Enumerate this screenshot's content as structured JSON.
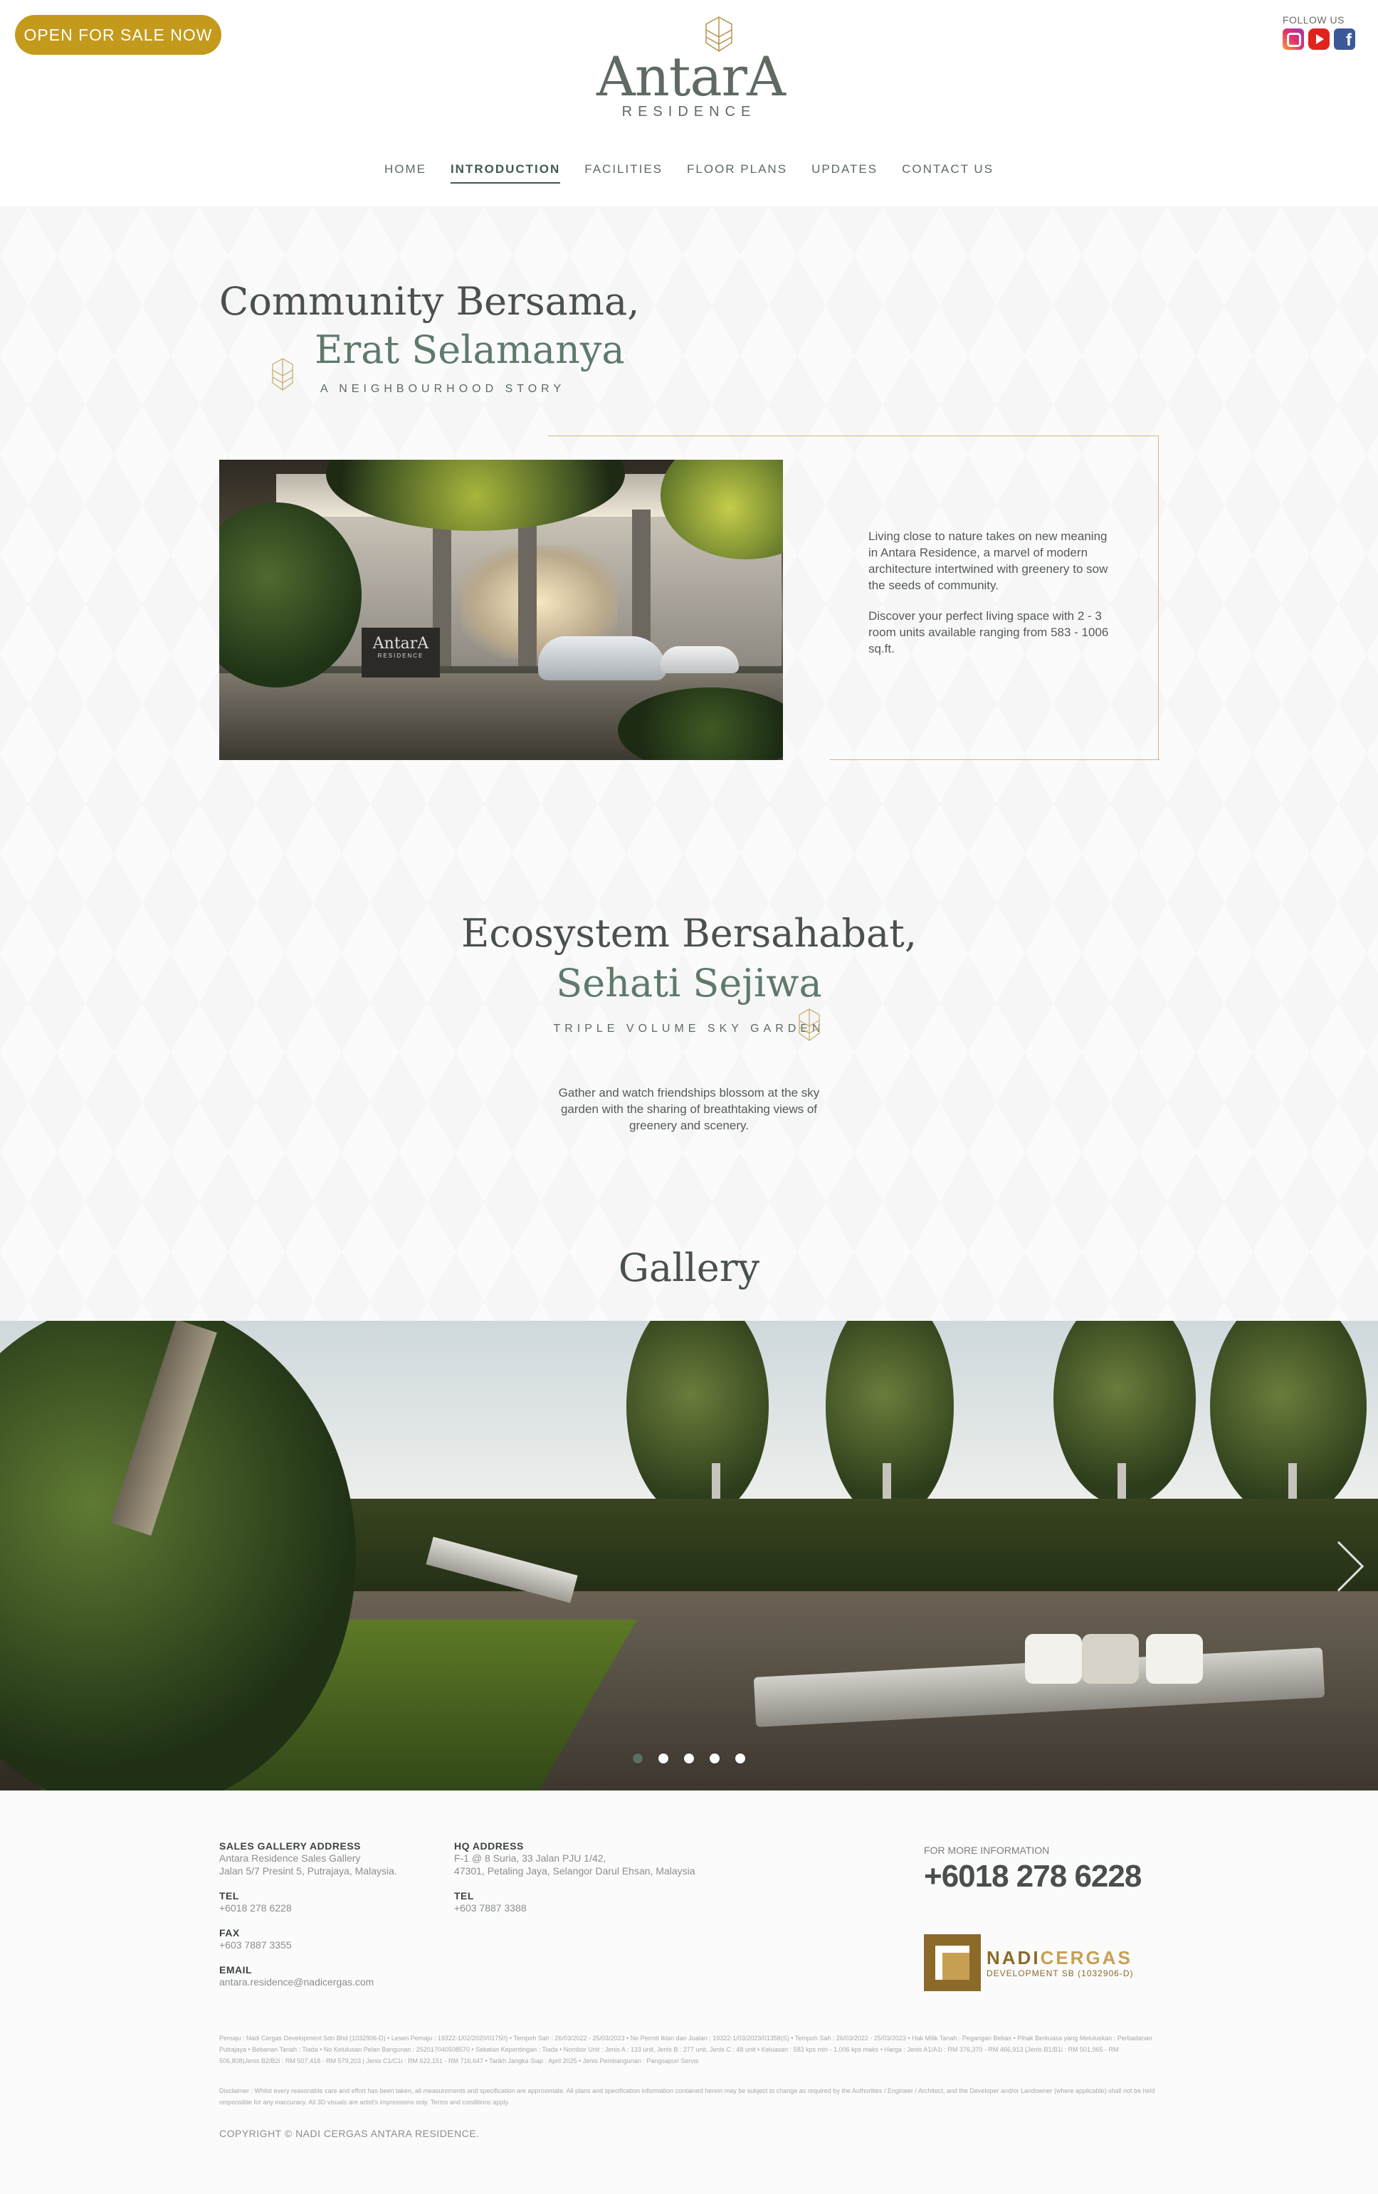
{
  "header": {
    "sale_button": "OPEN FOR SALE NOW",
    "logo_name": "AntarA",
    "logo_sub": "RESIDENCE",
    "follow_label": "FOLLOW US",
    "social_icons": [
      "instagram-icon",
      "youtube-icon",
      "facebook-icon"
    ]
  },
  "nav": {
    "items": [
      {
        "label": "HOME"
      },
      {
        "label": "INTRODUCTION",
        "active": true
      },
      {
        "label": "FACILITIES"
      },
      {
        "label": "FLOOR PLANS"
      },
      {
        "label": "UPDATES"
      },
      {
        "label": "CONTACT US"
      }
    ]
  },
  "section1": {
    "title_line1": "Community Bersama,",
    "title_line2": "Erat Selamanya",
    "subtitle": "A NEIGHBOURHOOD STORY",
    "photo_sign": "AntarA",
    "photo_sign_sub": "RESIDENCE",
    "paragraph1": "Living close to nature takes on new meaning in Antara Residence, a marvel of modern architecture intertwined with greenery to sow the seeds of community.",
    "paragraph2": "Discover your perfect living space with 2 - 3 room units available ranging from 583 - 1006 sq.ft."
  },
  "section2": {
    "title_line1": "Ecosystem Bersahabat,",
    "title_line2": "Sehati Sejiwa",
    "subtitle": "TRIPLE VOLUME SKY GARDEN",
    "paragraph": "Gather and watch friendships blossom at the sky garden with the sharing of breathtaking views of greenery and scenery."
  },
  "gallery": {
    "title": "Gallery",
    "slide_count": 5,
    "active_slide": 1
  },
  "footer": {
    "sales_gallery": {
      "heading": "SALES GALLERY ADDRESS",
      "line1": "Antara Residence Sales Gallery",
      "line2": "Jalan 5/7 Presint 5, Putrajaya, Malaysia."
    },
    "hq": {
      "heading": "HQ ADDRESS",
      "line1": "F-1 @ 8 Suria, 33 Jalan PJU 1/42,",
      "line2": "47301, Petaling Jaya, Selangor Darul Ehsan, Malaysia"
    },
    "tel_heading": "TEL",
    "sales_tel": "+6018 278 6228",
    "hq_tel": "+603 7887 3388",
    "fax_heading": "FAX",
    "fax": "+603 7887 3355",
    "email_heading": "EMAIL",
    "email": "antara.residence@nadicergas.com",
    "more_info_label": "FOR MORE INFORMATION",
    "more_info_phone": "+6018 278 6228",
    "developer_name_a": "NADI",
    "developer_name_b": "CERGAS",
    "developer_sub": "DEVELOPMENT SB (1032906-D)",
    "fine_print_1": "Pemaju : Nadi Cergas Development Sdn Bhd (1032906-D) • Lesen Pemaju : 19322-1/02/2020/01750) • Tempoh Sah : 26/03/2022 - 25/03/2023 • No Permit Iklan dan Jualan : 19322-1/03/2023/01358(S) • Tempoh Sah : 26/03/2022 - 25/03/2023 • Hak Milik Tanah : Pegangan Bebas • Pihak Berkuasa yang Meluluskan : Perbadanan Putrajaya • Bebanan Tanah : Tiada • No Kelulusan Pelan Bangunan : 252017040508570 • Sekatan Kepentingan : Tiada • Nombor Unit : Jenis A : 133 unit, Jenis B : 277 unit, Jenis C : 48 unit • Keluasan : 583 kps min - 1,006 kps maks • Harga : Jenis A1/A1i : RM 376,370 - RM 466,913 (Jenis B1/B1i : RM 501,965 - RM 506,808)Jenis B2/B2i : RM 507,418 - RM 579,203 | Jenis C1/C1i : RM 622,151 - RM 716,647 • Tarikh Jangka Siap : April 2025 • Jenis Pembangunan : Pangsapuri Servis",
    "fine_print_2": "Disclaimer : Whilst every reasonable care and effort has been taken, all measurements and specification are approximate. All plans and specification information contained herein may be subject to change as required by the Authorities / Engineer / Architect, and the Developer and/or Landowner (where applicable) shall not be held responsible for any inaccuracy. All 3D visuals are artist's impressions only. Terms and conditions apply.",
    "copyright": "COPYRIGHT © NADI CERGAS ANTARA RESIDENCE."
  },
  "colors": {
    "accent_gold": "#c39a1c",
    "frame_gold": "#d9b374",
    "green_heading": "#5e7a6b",
    "dark_heading": "#4a514d"
  }
}
